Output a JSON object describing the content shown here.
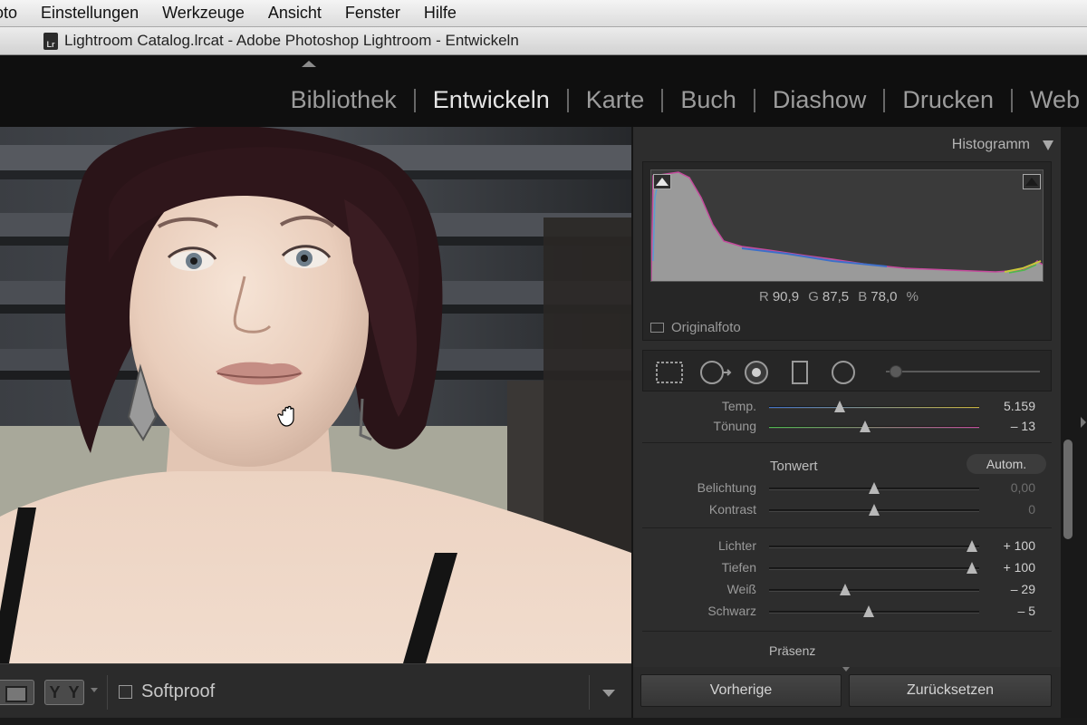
{
  "menubar": {
    "items": [
      "oto",
      "Einstellungen",
      "Werkzeuge",
      "Ansicht",
      "Fenster",
      "Hilfe"
    ]
  },
  "window": {
    "icon_text": "Lr",
    "title": "Lightroom Catalog.lrcat - Adobe Photoshop Lightroom - Entwickeln"
  },
  "modules": {
    "items": [
      {
        "label": "Bibliothek",
        "active": false
      },
      {
        "label": "Entwickeln",
        "active": true
      },
      {
        "label": "Karte",
        "active": false
      },
      {
        "label": "Buch",
        "active": false
      },
      {
        "label": "Diashow",
        "active": false
      },
      {
        "label": "Drucken",
        "active": false
      },
      {
        "label": "Web",
        "active": false
      }
    ]
  },
  "toolbar": {
    "yy_label": "Y|Y",
    "softproof_label": "Softproof",
    "softproof_checked": false
  },
  "histogram": {
    "title": "Histogramm",
    "r_label": "R",
    "r_value": "90,9",
    "g_label": "G",
    "g_value": "87,5",
    "b_label": "B",
    "b_value": "78,0",
    "unit": "%",
    "original_label": "Originalfoto"
  },
  "tools": {
    "icons": [
      "crop-overlay-icon",
      "spot-removal-icon",
      "red-eye-icon",
      "graduated-filter-icon",
      "radial-filter-icon"
    ]
  },
  "basic": {
    "temp": {
      "label": "Temp.",
      "value": "5.159"
    },
    "tint": {
      "label": "Tönung",
      "value": "– 13"
    },
    "tone_title": "Tonwert",
    "auto_label": "Autom.",
    "exposure": {
      "label": "Belichtung",
      "value": "0,00"
    },
    "contrast": {
      "label": "Kontrast",
      "value": "0"
    },
    "highlights": {
      "label": "Lichter",
      "value": "+ 100"
    },
    "shadows": {
      "label": "Tiefen",
      "value": "+ 100"
    },
    "whites": {
      "label": "Weiß",
      "value": "– 29"
    },
    "blacks": {
      "label": "Schwarz",
      "value": "– 5"
    },
    "presence_title": "Präsenz"
  },
  "buttons": {
    "previous": "Vorherige",
    "reset": "Zurücksetzen"
  },
  "colors": {
    "panel_bg": "#2d2d2d",
    "active_module": "#e6e6e6",
    "inactive_module": "#9c9c9c"
  }
}
